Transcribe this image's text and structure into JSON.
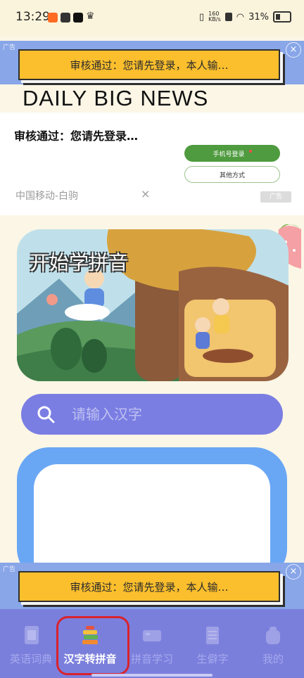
{
  "status": {
    "time": "13:29",
    "net_speed": "160\nKB/s",
    "battery": "31%"
  },
  "top_ad": {
    "tag": "广告",
    "text": "审核通过：您请先登录，本人输…"
  },
  "headline": "DAILY BIG NEWS",
  "login_card": {
    "title": "审核通过：您请先登录…",
    "phone_login": "手机号登录",
    "other_method": "其他方式",
    "carrier": "中国移动-白驹",
    "close": "×",
    "ad_tag": "广告"
  },
  "hero": {
    "title": "开始学拼音"
  },
  "search": {
    "placeholder": "请输入汉字"
  },
  "bottom_ad": {
    "tag": "广告",
    "text": "审核通过：您请先登录，本人输…"
  },
  "nav": {
    "items": [
      {
        "label": "英语词典",
        "icon": "dictionary-icon"
      },
      {
        "label": "汉字转拼音",
        "icon": "books-stack-icon"
      },
      {
        "label": "拼音学习",
        "icon": "keyboard-icon"
      },
      {
        "label": "生僻字",
        "icon": "notepad-icon"
      },
      {
        "label": "我的",
        "icon": "backpack-icon"
      }
    ],
    "active_index": 1
  },
  "colors": {
    "accent": "#7b7fdc",
    "search_bg": "#7a7ee3",
    "panel_blue": "#69a7f5",
    "highlight": "#d9232d"
  }
}
